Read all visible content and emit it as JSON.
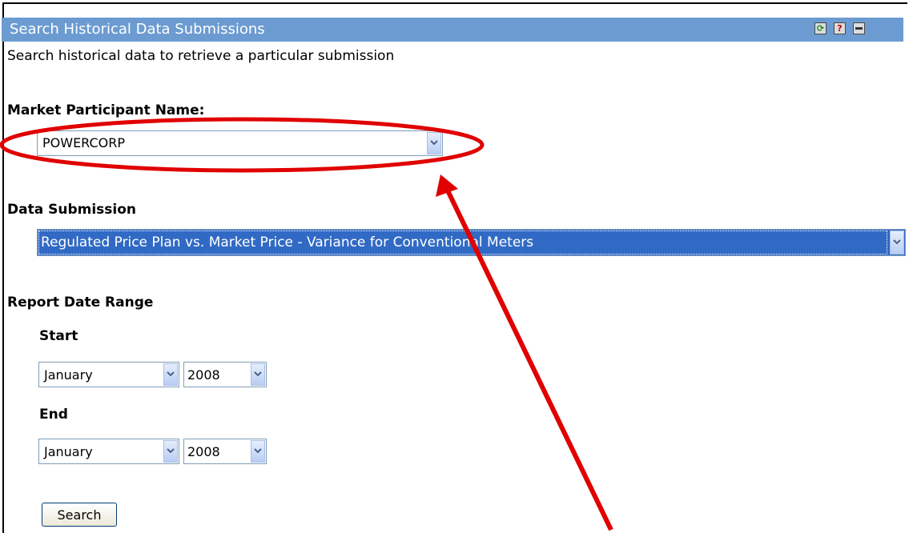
{
  "panel": {
    "title": "Search Historical Data Submissions",
    "description": "Search historical data to retrieve a particular submission",
    "header_icons": [
      "refresh-icon",
      "help-icon",
      "minimize-icon"
    ],
    "header_color": "#6b9bd1"
  },
  "form": {
    "participant_label": "Market Participant Name:",
    "participant_value": "POWERCORP",
    "submission_label": "Data Submission",
    "submission_value": "Regulated Price Plan vs. Market Price - Variance for Conventional Meters",
    "date_range_label": "Report Date Range",
    "start_label": "Start",
    "start_month": "January",
    "start_year": "2008",
    "end_label": "End",
    "end_month": "January",
    "end_year": "2008",
    "search_label": "Search"
  },
  "annotation": {
    "color": "#e00000"
  }
}
